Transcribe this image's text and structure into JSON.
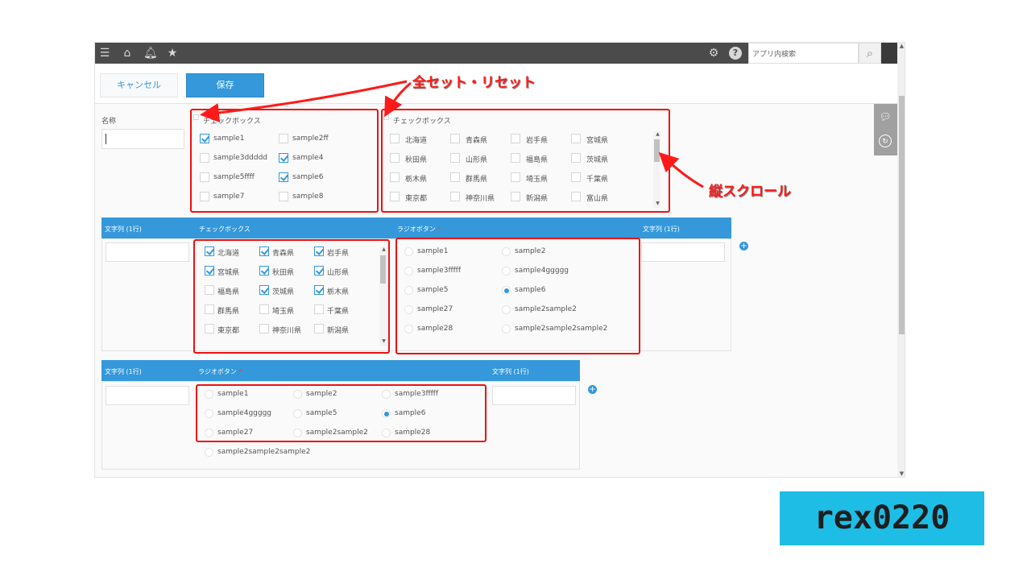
{
  "header": {
    "search_placeholder": "アプリ内検索",
    "icons": [
      "menu-icon",
      "home-icon",
      "bell-icon",
      "star-icon",
      "gear-icon",
      "help-icon",
      "search-icon"
    ]
  },
  "actions": {
    "cancel_label": "キャンセル",
    "save_label": "保存"
  },
  "form": {
    "name_label": "名称",
    "row1": {
      "cb1": {
        "title": "チェックボックス",
        "items": [
          {
            "label": "sample1",
            "checked": true
          },
          {
            "label": "sample2ff",
            "checked": false
          },
          {
            "label": "sample3ddddd",
            "checked": false
          },
          {
            "label": "sample4",
            "checked": true
          },
          {
            "label": "sample5ffff",
            "checked": false
          },
          {
            "label": "sample6",
            "checked": true
          },
          {
            "label": "sample7",
            "checked": false
          },
          {
            "label": "sample8",
            "checked": false
          }
        ]
      },
      "cb2": {
        "title": "チェックボックス",
        "items": [
          "北海道",
          "青森県",
          "岩手県",
          "宮城県",
          "秋田県",
          "山形県",
          "福島県",
          "茨城県",
          "栃木県",
          "群馬県",
          "埼玉県",
          "千葉県",
          "東京都",
          "神奈川県",
          "新潟県",
          "富山県"
        ]
      }
    },
    "row2": {
      "headers": [
        "文字列 (1行)",
        "チェックボックス",
        "ラジオボタン",
        "文字列 (1行)"
      ],
      "required_mark": "*",
      "prefs": [
        {
          "label": "北海道",
          "checked": true
        },
        {
          "label": "青森県",
          "checked": true
        },
        {
          "label": "岩手県",
          "checked": true
        },
        {
          "label": "宮城県",
          "checked": true
        },
        {
          "label": "秋田県",
          "checked": true
        },
        {
          "label": "山形県",
          "checked": true
        },
        {
          "label": "福島県",
          "checked": false
        },
        {
          "label": "茨城県",
          "checked": true
        },
        {
          "label": "栃木県",
          "checked": true
        },
        {
          "label": "群馬県",
          "checked": false
        },
        {
          "label": "埼玉県",
          "checked": false
        },
        {
          "label": "千葉県",
          "checked": false
        },
        {
          "label": "東京都",
          "checked": false
        },
        {
          "label": "神奈川県",
          "checked": false
        },
        {
          "label": "新潟県",
          "checked": false
        }
      ],
      "radios": [
        {
          "label": "sample1",
          "checked": false
        },
        {
          "label": "sample2",
          "checked": false
        },
        {
          "label": "sample3fffff",
          "checked": false
        },
        {
          "label": "sample4ggggg",
          "checked": false
        },
        {
          "label": "sample5",
          "checked": false
        },
        {
          "label": "sample6",
          "checked": true
        },
        {
          "label": "sample27",
          "checked": false
        },
        {
          "label": "sample2sample2",
          "checked": false
        },
        {
          "label": "sample28",
          "checked": false
        },
        {
          "label": "sample2sample2sample2",
          "checked": false
        }
      ]
    },
    "row3": {
      "headers": [
        "文字列 (1行)",
        "ラジオボタン",
        "文字列 (1行)"
      ],
      "radios": [
        {
          "label": "sample1",
          "checked": false
        },
        {
          "label": "sample2",
          "checked": false
        },
        {
          "label": "sample3fffff",
          "checked": false
        },
        {
          "label": "sample4ggggg",
          "checked": false
        },
        {
          "label": "sample5",
          "checked": false
        },
        {
          "label": "sample6",
          "checked": true
        },
        {
          "label": "sample27",
          "checked": false
        },
        {
          "label": "sample2sample2",
          "checked": false
        },
        {
          "label": "sample28",
          "checked": false
        },
        {
          "label": "sample2sample2sample2",
          "checked": false
        }
      ]
    }
  },
  "annotations": {
    "set_reset": "全セット・リセット",
    "vertical_scroll": "縦スクロール"
  },
  "watermark": "rex0220",
  "colors": {
    "accent": "#3498db",
    "header_bg": "#4b4b4b",
    "annotation": "#ff1a1a",
    "badge_bg": "#1ebde6"
  }
}
